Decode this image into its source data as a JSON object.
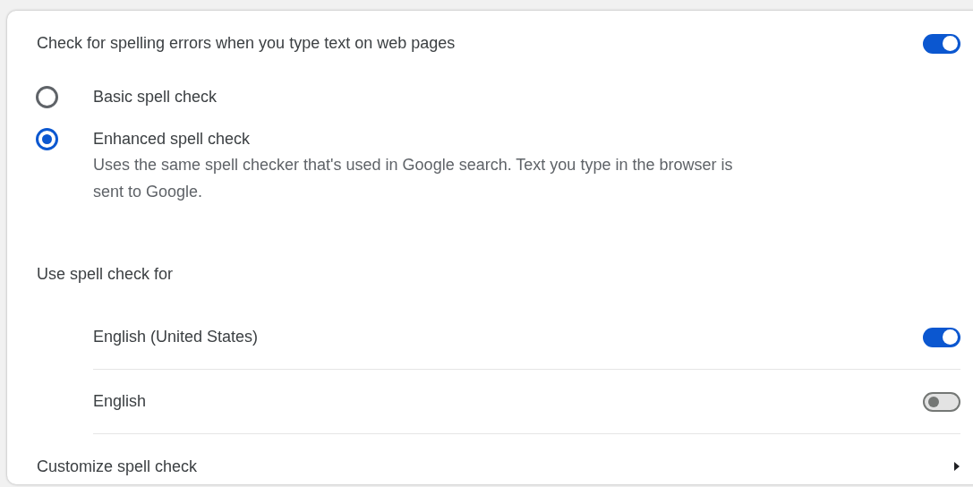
{
  "spellcheck": {
    "label": "Check for spelling errors when you type text on web pages",
    "on": true
  },
  "modes": [
    {
      "label": "Basic spell check",
      "selected": false
    },
    {
      "label": "Enhanced spell check",
      "selected": true,
      "description": "Uses the same spell checker that's used in Google search. Text you type in the browser is sent to Google."
    }
  ],
  "languages_heading": "Use spell check for",
  "languages": [
    {
      "label": "English (United States)",
      "on": true
    },
    {
      "label": "English",
      "on": false
    }
  ],
  "customize": {
    "label": "Customize spell check"
  }
}
